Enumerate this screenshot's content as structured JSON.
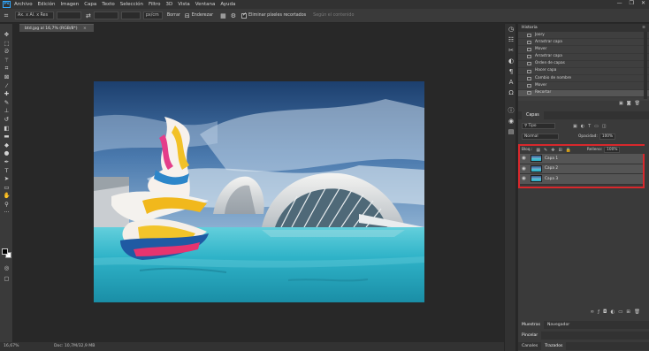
{
  "app": {
    "logo": "Ps"
  },
  "menu": [
    "Archivo",
    "Edición",
    "Imagen",
    "Capa",
    "Texto",
    "Selección",
    "Filtro",
    "3D",
    "Vista",
    "Ventana",
    "Ayuda"
  ],
  "window_controls": [
    "—",
    "❐",
    "✕"
  ],
  "options": {
    "ratio_select": "Ax. x Al. x Res",
    "unit_select": "px/cm",
    "clear_label": "Borrar",
    "straighten_label": "Enderezar",
    "delete_cropped_label": "Eliminar píxeles recortados",
    "content_aware_label": "Según el contenido"
  },
  "document": {
    "tab_title": "btd.jpg al 16,7% (RGB/8*)",
    "close": "×"
  },
  "status": {
    "zoom": "16,67%",
    "doc_info": "Doc: 10,7M/32,9 MB"
  },
  "history": {
    "tab": "Historia",
    "items": [
      "Joory",
      "Arrastrar capa",
      "Mover",
      "Arrastrar capa",
      "Orden de capas",
      "Hacer capa",
      "Cambio de nombre",
      "Mover",
      "Recortar"
    ],
    "selected_index": 8
  },
  "layers": {
    "tab": "Capas",
    "filter_label": "Tipo",
    "blend_mode": "Normal",
    "opacity_label": "Opacidad:",
    "opacity_value": "100%",
    "lock_label": "Bloq.:",
    "fill_label": "Relleno:",
    "fill_value": "100%",
    "items": [
      {
        "name": "Capa 1"
      },
      {
        "name": "Capa 2"
      },
      {
        "name": "Capa 3"
      }
    ]
  },
  "bottom_tabs": {
    "row1": [
      "Muestras",
      "Navegador"
    ],
    "row2": [
      "Pincelar"
    ],
    "row3": [
      "Canales",
      "Trazados"
    ]
  },
  "colors": {
    "highlight_border": "#d8282c",
    "accent": "#31a8ff"
  }
}
